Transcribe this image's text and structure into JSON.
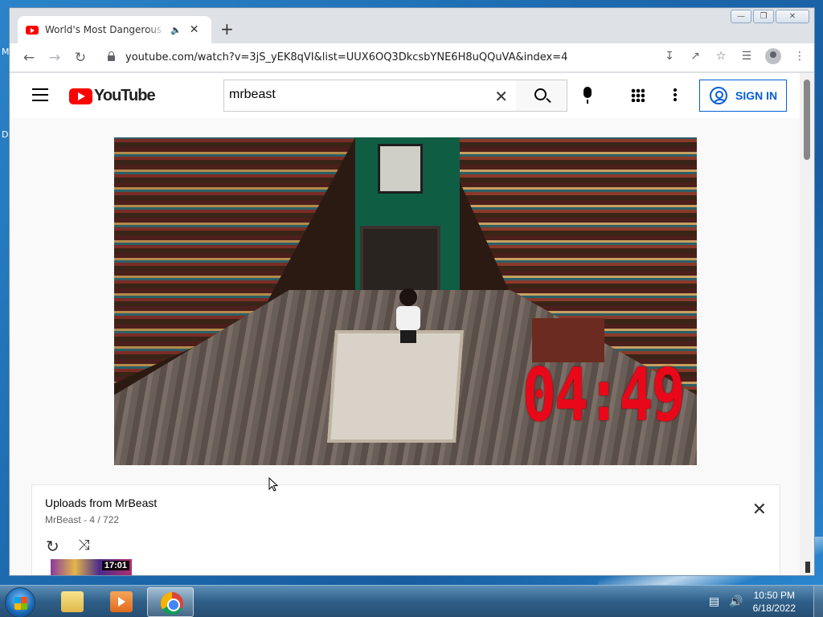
{
  "desktop": {
    "letters": [
      "M",
      "D"
    ]
  },
  "browser": {
    "tab": {
      "title": "World's Most Dangerous Esc",
      "audio": "🔈",
      "close": "✕"
    },
    "new_tab": "+",
    "url": "youtube.com/watch?v=3jS_yEK8qVI&list=UUX6OQ3DkcsbYNE6H8uQQuVA&index=4",
    "controls": {
      "minimize": "—",
      "restore": "❐",
      "close": "✕"
    }
  },
  "youtube": {
    "logo_text": "YouTube",
    "search_value": "mrbeast",
    "search_clear": "✕",
    "signin_label": "SIGN IN"
  },
  "video": {
    "timer": "04:49"
  },
  "playlist": {
    "title": "Uploads from MrBeast",
    "subtitle": "MrBeast - 4 / 722",
    "close": "✕",
    "loop_icon": "↻",
    "shuffle_icon": "⤨",
    "thumb_duration": "17:01"
  },
  "taskbar": {
    "time": "10:50 PM",
    "date": "6/18/2022"
  }
}
